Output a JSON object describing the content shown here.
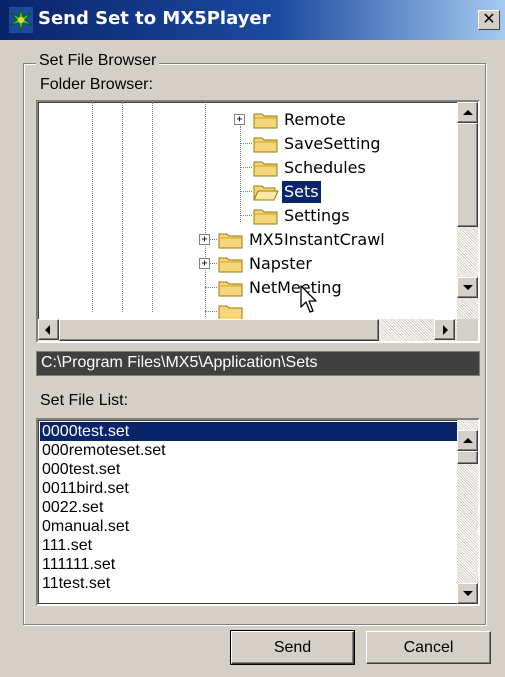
{
  "window": {
    "title": "Send Set to MX5Player",
    "close_glyph": "✕"
  },
  "group": {
    "legend": "Set File Browser"
  },
  "folder_browser": {
    "label": "Folder Browser:",
    "nodes": [
      {
        "label": "Remote",
        "expandable": true,
        "selected": false
      },
      {
        "label": "SaveSetting",
        "expandable": false,
        "selected": false
      },
      {
        "label": "Schedules",
        "expandable": false,
        "selected": false
      },
      {
        "label": "Sets",
        "expandable": false,
        "selected": true
      },
      {
        "label": "Settings",
        "expandable": false,
        "selected": false
      },
      {
        "label": "MX5InstantCrawl",
        "expandable": true,
        "selected": false
      },
      {
        "label": "Napster",
        "expandable": true,
        "selected": false
      },
      {
        "label": "NetMeeting",
        "expandable": false,
        "selected": false
      }
    ]
  },
  "path": {
    "value": "C:\\Program Files\\MX5\\Application\\Sets"
  },
  "set_file_list": {
    "label": "Set File List:",
    "items": [
      "0000test.set",
      "000remoteset.set",
      "000test.set",
      "0011bird.set",
      "0022.set",
      "0manual.set",
      "111.set",
      "111111.set",
      "11test.set"
    ],
    "selected_index": 0
  },
  "buttons": {
    "send": "Send",
    "cancel": "Cancel"
  },
  "icons": {
    "app": "app-icon",
    "folder": "folder-icon",
    "close": "close-icon",
    "cursor": "mouse-cursor-icon"
  },
  "colors": {
    "title_start": "#0a246a",
    "title_end": "#a6caf0",
    "selection": "#0a246a",
    "folder": "#f5d77a"
  }
}
